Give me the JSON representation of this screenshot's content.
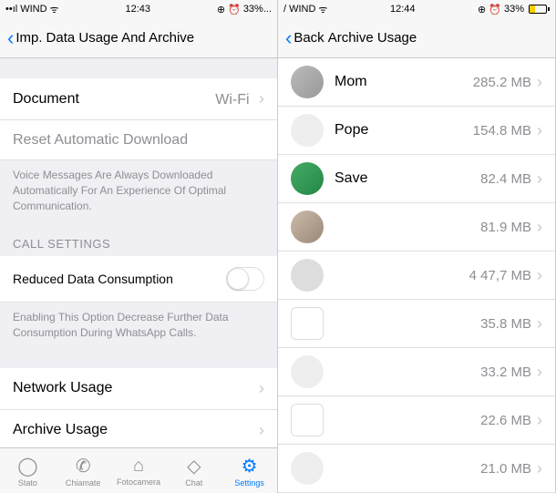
{
  "left": {
    "status": {
      "carrier": "WIND",
      "time": "12:43",
      "battery": "33%..."
    },
    "nav": {
      "back": "Imp.",
      "title": "Data Usage And Archive"
    },
    "rows": {
      "document": {
        "label": "Document",
        "value": "Wi-Fi"
      },
      "reset": {
        "label": "Reset Automatic Download"
      }
    },
    "note1": "Voice Messages Are Always Downloaded Automatically For An Experience Of Optimal Communication.",
    "call_header": "CALL SETTINGS",
    "reduced": {
      "label": "Reduced Data Consumption"
    },
    "note2": "Enabling This Option Decrease Further Data Consumption During WhatsApp Calls.",
    "network": {
      "label": "Network Usage"
    },
    "archive": {
      "label": "Archive Usage"
    },
    "tabs": {
      "stato": "Stato",
      "chiamate": "Chiamate",
      "fotocamera": "Fotocamera",
      "chat": "Chat",
      "settings": "Settings"
    }
  },
  "right": {
    "status": {
      "carrier": "WIND",
      "time": "12:44",
      "battery": "33%"
    },
    "nav": {
      "back": "Back",
      "title": "Archive Usage"
    },
    "items": [
      {
        "name": "Mom",
        "size": "285.2 MB"
      },
      {
        "name": "Pope",
        "size": "154.8 MB"
      },
      {
        "name": "Save",
        "size": "82.4 MB"
      },
      {
        "name": "",
        "size": "81.9 MB"
      },
      {
        "name": "",
        "size": "4 47,7 MB"
      },
      {
        "name": "",
        "size": "35.8 MB"
      },
      {
        "name": "",
        "size": "33.2 MB"
      },
      {
        "name": "",
        "size": "22.6 MB"
      },
      {
        "name": "",
        "size": "21.0 MB"
      }
    ]
  }
}
